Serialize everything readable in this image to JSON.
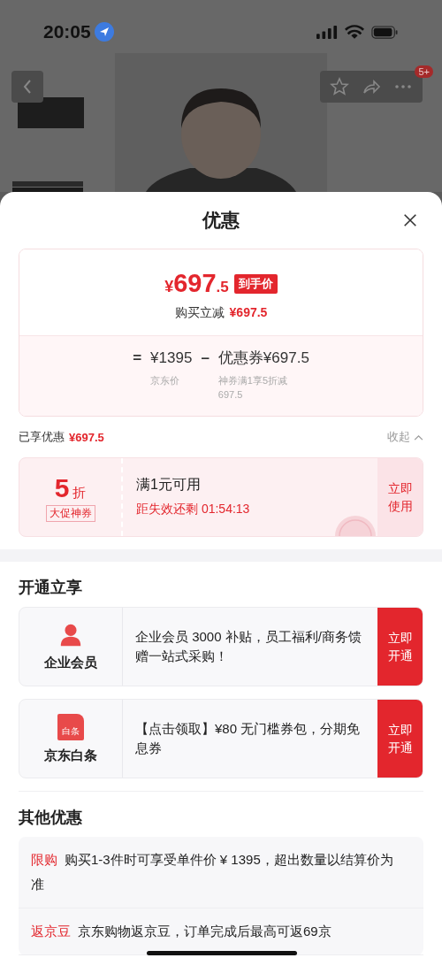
{
  "status_bar": {
    "time": "20:05"
  },
  "nav": {
    "badge": "5+"
  },
  "sheet": {
    "title": "优惠",
    "summary": {
      "currency": "¥",
      "price_int": "697",
      "price_dec": ".5",
      "price_tag": "到手价",
      "reduction_label": "购买立减",
      "reduction_value": "¥697.5",
      "formula": [
        {
          "kind": "op",
          "text": "="
        },
        {
          "kind": "term",
          "value": "¥1395",
          "caption": [
            "京东价"
          ]
        },
        {
          "kind": "op",
          "text": "–"
        },
        {
          "kind": "term",
          "value": "优惠券¥697.5",
          "caption": [
            "神券满1享5折减",
            "697.5"
          ]
        }
      ]
    },
    "enjoyed": {
      "label": "已享优惠",
      "value": "¥697.5",
      "toggle": "收起",
      "expanded": true
    },
    "coupon": {
      "discount": "5",
      "unit": "折",
      "tag": "大促神券",
      "condition": "满1元可用",
      "countdown": "距失效还剩 01:54:13",
      "action": "立即使用"
    },
    "open_section": {
      "title": "开通立享",
      "items": [
        {
          "kind": "member",
          "name": "企业会员",
          "desc": "企业会员 3000 补贴，员工福利/商务馈赠一站式采购！",
          "action": "立即开通"
        },
        {
          "kind": "baitiao",
          "name": "京东白条",
          "icon_text": "白条",
          "desc": "【点击领取】¥80 无门槛券包，分期免息券",
          "action": "立即开通"
        }
      ]
    },
    "other_section": {
      "title": "其他优惠",
      "items": [
        {
          "tag": "限购",
          "text": "购买1-3件时可享受单件价 ¥ 1395，超出数量以结算价为准"
        },
        {
          "tag": "返京豆",
          "text": "京东购物返京豆，订单完成后最高可返69京"
        }
      ]
    }
  }
}
